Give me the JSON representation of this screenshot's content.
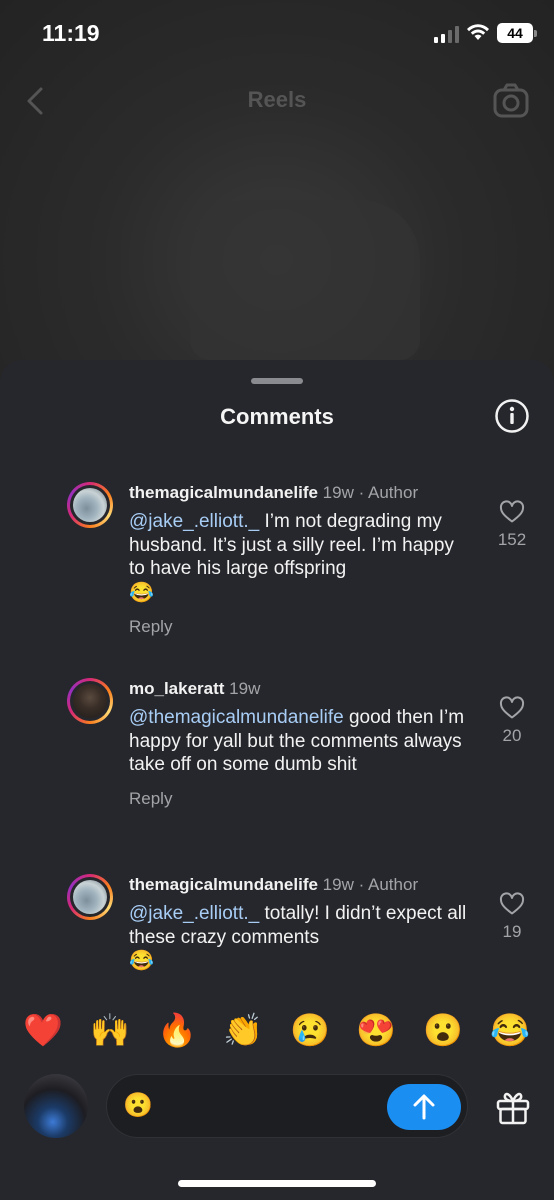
{
  "status_bar": {
    "time": "11:19",
    "battery": "44"
  },
  "top_nav": {
    "title": "Reels"
  },
  "sheet": {
    "title": "Comments"
  },
  "comments": [
    {
      "username": "themagicalmundanelife",
      "meta": " 19w · Author",
      "mention": "@jake_.elliott._",
      "text": " I’m not degrading my husband. It’s just a silly reel. I’m happy to have his large offspring",
      "emoji": "😂",
      "reply": "Reply",
      "likes": "152"
    },
    {
      "username": "mo_lakeratt",
      "meta": " 19w",
      "mention": "@themagicalmundanelife",
      "text": " good then I’m happy for yall but the comments always take off on some dumb shit",
      "emoji": "",
      "reply": "Reply",
      "likes": "20"
    },
    {
      "username": "themagicalmundanelife",
      "meta": " 19w · Author",
      "mention": "@jake_.elliott._",
      "text": " totally! I didn’t expect all these crazy comments",
      "emoji": "😂",
      "reply": "",
      "likes": "19"
    }
  ],
  "emoji_bar": [
    "❤️",
    "🙌",
    "🔥",
    "👏",
    "😢",
    "😍",
    "😮",
    "😂"
  ],
  "composer": {
    "input_value": "😮"
  },
  "colors": {
    "accent": "#1b8ef2",
    "mention": "#a8cdf5",
    "sheet_bg": "#26272c"
  }
}
